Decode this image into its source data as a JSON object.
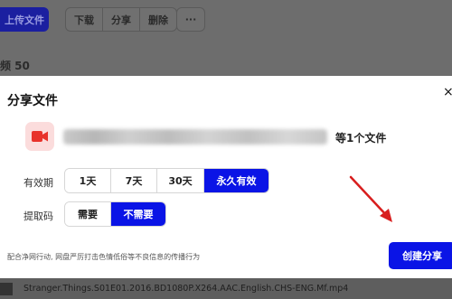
{
  "background": {
    "upload_label": "上传文件",
    "toolbar": [
      "下载",
      "分享",
      "删除"
    ],
    "more_label": "···",
    "count_text": "频 50",
    "file_name": "Stranger.Things.S01E01.2016.BD1080P.X264.AAC.English.CHS-ENG.Mf.mp4"
  },
  "modal": {
    "title": "分享文件",
    "close_label": "×",
    "file_count": "等1个文件",
    "validity": {
      "label": "有效期",
      "options": [
        "1天",
        "7天",
        "30天",
        "永久有效"
      ],
      "selected": "永久有效"
    },
    "code": {
      "label": "提取码",
      "options": [
        "需要",
        "不需要"
      ],
      "selected": "不需要"
    },
    "notice": "配合净网行动, 网盘严厉打击色情低俗等不良信息的传播行为",
    "create_label": "创建分享"
  },
  "colors": {
    "accent": "#0a14e6",
    "file_icon_bg": "#fbdcdc",
    "file_icon_fg": "#e8322b",
    "annotation_arrow": "#d81e1e"
  },
  "icons": {
    "file": "video-camera-icon",
    "close": "close-icon",
    "annotation": "red-arrow"
  }
}
